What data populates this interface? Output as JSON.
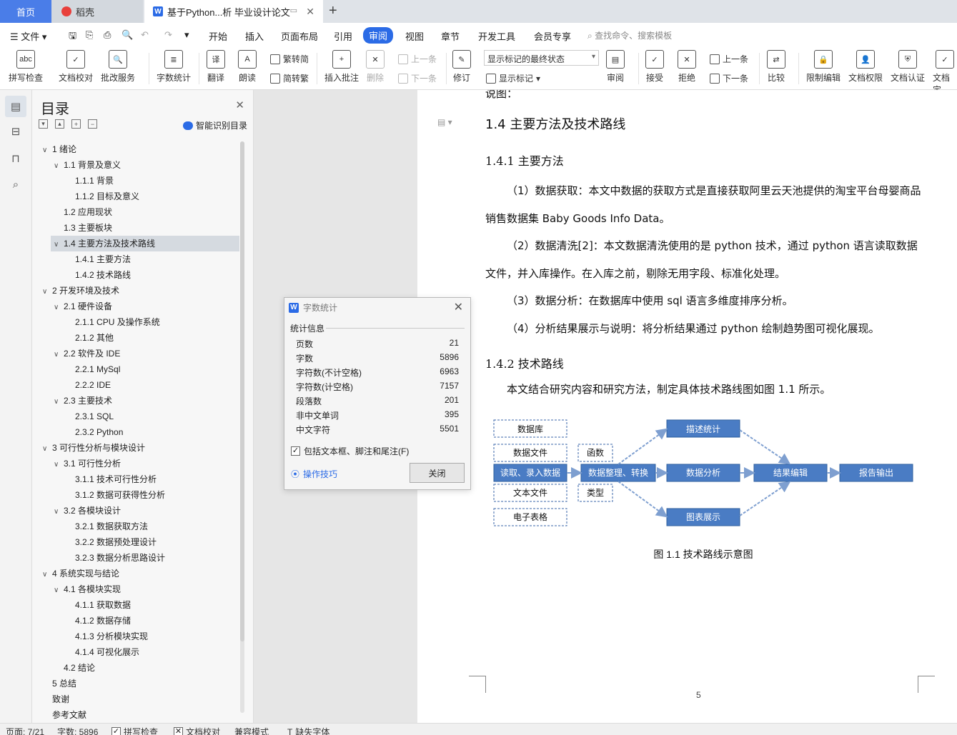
{
  "tabs": {
    "home": "首页",
    "daoke": "稻壳",
    "doc": "基于Python...析 毕业设计论文"
  },
  "menu": {
    "file": "文件",
    "items": [
      "开始",
      "插入",
      "页面布局",
      "引用",
      "审阅",
      "视图",
      "章节",
      "开发工具",
      "会员专享"
    ],
    "active": "审阅",
    "search": "查找命令、搜索模板"
  },
  "ribbon": {
    "spell": "拼写检查",
    "proof": "文档校对",
    "batch": "批改服务",
    "wordcount": "字数统计",
    "translate": "翻译",
    "read": "朗读",
    "trad": "繁转简",
    "simp": "简转繁",
    "insert_comment": "插入批注",
    "delete": "删除",
    "prev": "上一条",
    "next": "下一条",
    "revise": "修订",
    "markup_select": "显示标记的最终状态",
    "show_markup": "显示标记",
    "review": "审阅",
    "accept": "接受",
    "reject": "拒绝",
    "prev2": "上一条",
    "next2": "下一条",
    "compare": "比较",
    "restrict": "限制编辑",
    "perm": "文档权限",
    "cert": "文档认证",
    "final": "文档定"
  },
  "toc": {
    "title": "目录",
    "smart": "智能识别目录",
    "items": [
      {
        "label": "1  绪论",
        "level": 0,
        "caret": true
      },
      {
        "label": "1.1  背景及意义",
        "level": 1,
        "caret": true
      },
      {
        "label": "1.1.1  背景",
        "level": 2,
        "caret": false
      },
      {
        "label": "1.1.2  目标及意义",
        "level": 2,
        "caret": false
      },
      {
        "label": "1.2  应用现状",
        "level": 1,
        "caret": false
      },
      {
        "label": "1.3  主要板块",
        "level": 1,
        "caret": false
      },
      {
        "label": "1.4  主要方法及技术路线",
        "level": 1,
        "caret": true,
        "selected": true
      },
      {
        "label": "1.4.1  主要方法",
        "level": 2,
        "caret": false
      },
      {
        "label": "1.4.2  技术路线",
        "level": 2,
        "caret": false
      },
      {
        "label": "2 开发环境及技术",
        "level": 0,
        "caret": true
      },
      {
        "label": "2.1 硬件设备",
        "level": 1,
        "caret": true
      },
      {
        "label": "2.1.1 CPU 及操作系统",
        "level": 2,
        "caret": false
      },
      {
        "label": "2.1.2 其他",
        "level": 2,
        "caret": false
      },
      {
        "label": "2.2 软件及 IDE",
        "level": 1,
        "caret": true
      },
      {
        "label": "2.2.1 MySql",
        "level": 2,
        "caret": false
      },
      {
        "label": "2.2.2 IDE",
        "level": 2,
        "caret": false
      },
      {
        "label": "2.3 主要技术",
        "level": 1,
        "caret": true
      },
      {
        "label": "2.3.1 SQL",
        "level": 2,
        "caret": false
      },
      {
        "label": "2.3.2 Python",
        "level": 2,
        "caret": false
      },
      {
        "label": "3  可行性分析与模块设计",
        "level": 0,
        "caret": true
      },
      {
        "label": "3.1  可行性分析",
        "level": 1,
        "caret": true
      },
      {
        "label": "3.1.1  技术可行性分析",
        "level": 2,
        "caret": false
      },
      {
        "label": "3.1.2  数据可获得性分析",
        "level": 2,
        "caret": false
      },
      {
        "label": "3.2  各模块设计",
        "level": 1,
        "caret": true
      },
      {
        "label": "3.2.1  数据获取方法",
        "level": 2,
        "caret": false
      },
      {
        "label": "3.2.2  数据预处理设计",
        "level": 2,
        "caret": false
      },
      {
        "label": "3.2.3  数据分析思路设计",
        "level": 2,
        "caret": false
      },
      {
        "label": "4  系统实现与结论",
        "level": 0,
        "caret": true
      },
      {
        "label": "4.1  各模块实现",
        "level": 1,
        "caret": true
      },
      {
        "label": "4.1.1  获取数据",
        "level": 2,
        "caret": false
      },
      {
        "label": "4.1.2  数据存储",
        "level": 2,
        "caret": false
      },
      {
        "label": "4.1.3  分析模块实现",
        "level": 2,
        "caret": false
      },
      {
        "label": "4.1.4  可视化展示",
        "level": 2,
        "caret": false
      },
      {
        "label": "4.2  结论",
        "level": 1,
        "caret": false
      },
      {
        "label": "5 总结",
        "level": 0,
        "caret": false
      },
      {
        "label": "致谢",
        "level": 0,
        "caret": false
      },
      {
        "label": "参考文献",
        "level": 0,
        "caret": false
      }
    ]
  },
  "doc": {
    "partial_top": "说图：",
    "h2": "1.4  主要方法及技术路线",
    "h3a": "1.4.1  主要方法",
    "p1": "（1）数据获取：本文中数据的获取方式是直接获取阿里云天池提供的淘宝平台母婴商品销售数据集 Baby Goods Info Data。",
    "p2": "（2）数据清洗[2]：本文数据清洗使用的是 python 技术，通过 python 语言读取数据文件，并入库操作。在入库之前，剔除无用字段、标准化处理。",
    "p3": "（3）数据分析：在数据库中使用 sql 语言多维度排序分析。",
    "p4": "（4）分析结果展示与说明：将分析结果通过 python 绘制趋势图可视化展现。",
    "h3b": "1.4.2  技术路线",
    "p5": "本文结合研究内容和研究方法，制定具体技术路线图如图 1.1 所示。",
    "fig_caption": "图 1.1 技术路线示意图",
    "page_number": "5",
    "figure": {
      "sources": [
        "数据库",
        "数据文件",
        "读取、录入数据",
        "文本文件",
        "电子表格"
      ],
      "types": [
        "函数",
        "类型"
      ],
      "process": "数据整理、转换",
      "branches": [
        "描述统计",
        "数据分析",
        "图表展示"
      ],
      "merge": "结果编辑",
      "output": "报告输出"
    }
  },
  "dialog": {
    "title": "字数统计",
    "group": "统计信息",
    "rows": [
      {
        "label": "页数",
        "value": "21"
      },
      {
        "label": "字数",
        "value": "5896"
      },
      {
        "label": "字符数(不计空格)",
        "value": "6963"
      },
      {
        "label": "字符数(计空格)",
        "value": "7157"
      },
      {
        "label": "段落数",
        "value": "201"
      },
      {
        "label": "非中文单词",
        "value": "395"
      },
      {
        "label": "中文字符",
        "value": "5501"
      }
    ],
    "include": "包括文本框、脚注和尾注(F)",
    "tips": "操作技巧",
    "close": "关闭"
  },
  "status": {
    "page": "页面: 7/21",
    "words": "字数: 5896",
    "spell": "拼写检查",
    "proof": "文档校对",
    "compat": "兼容模式",
    "font": "缺失字体"
  },
  "colors": {
    "accent": "#2b6be6",
    "node_fill": "#4a7cc4",
    "node_border": "#2f5f9e"
  }
}
